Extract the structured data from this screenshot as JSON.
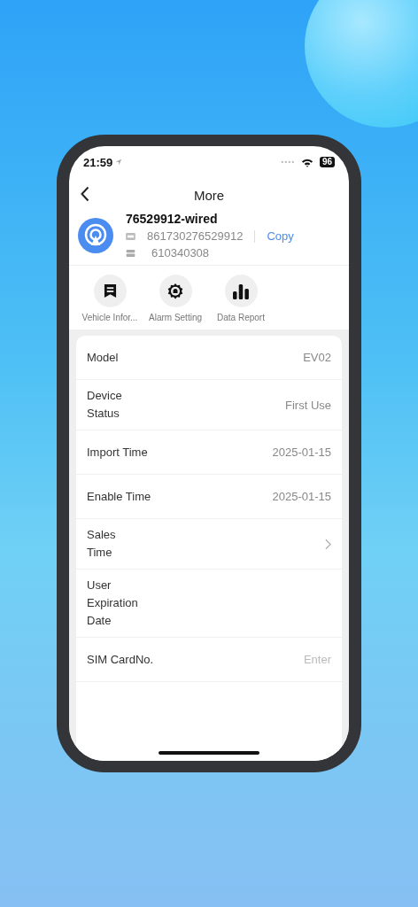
{
  "status_bar": {
    "time": "21:59",
    "battery": "96"
  },
  "header": {
    "title": "More"
  },
  "device": {
    "name": "76529912-wired",
    "imei": "861730276529912",
    "copy": "Copy",
    "serial": "610340308"
  },
  "actions": [
    {
      "label": "Vehicle Infor...",
      "kind": "vehicle"
    },
    {
      "label": "Alarm Setting",
      "kind": "alarm"
    },
    {
      "label": "Data Report",
      "kind": "report"
    }
  ],
  "rows": [
    {
      "label": "Model",
      "kind": "value",
      "value": "EV02"
    },
    {
      "label": "Device\nStatus",
      "kind": "value",
      "value": "First Use"
    },
    {
      "label": "Import Time",
      "kind": "value",
      "value": "2025-01-15"
    },
    {
      "label": "Enable Time",
      "kind": "value",
      "value": "2025-01-15"
    },
    {
      "label": "Sales\nTime",
      "kind": "link"
    },
    {
      "label": "User\nExpiration\nDate",
      "kind": "value"
    },
    {
      "label": "SIM CardNo.",
      "kind": "input",
      "placeholder": "Enter"
    }
  ]
}
